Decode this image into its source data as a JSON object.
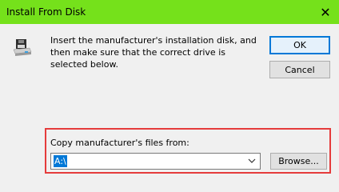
{
  "window": {
    "title": "Install From Disk",
    "close_glyph": "✕"
  },
  "message": "Insert the manufacturer's installation disk, and then make sure that the correct drive is selected below.",
  "buttons": {
    "ok": "OK",
    "cancel": "Cancel",
    "browse": "Browse..."
  },
  "copy": {
    "label": "Copy manufacturer's files from:",
    "value": "A:\\"
  },
  "icons": {
    "disk": "floppy-disk-icon",
    "dropdown": "chevron-down-icon",
    "close": "close-icon"
  },
  "colors": {
    "titlebar": "#75e11b",
    "highlight_border": "#e53c3c",
    "selection": "#0078d7"
  }
}
